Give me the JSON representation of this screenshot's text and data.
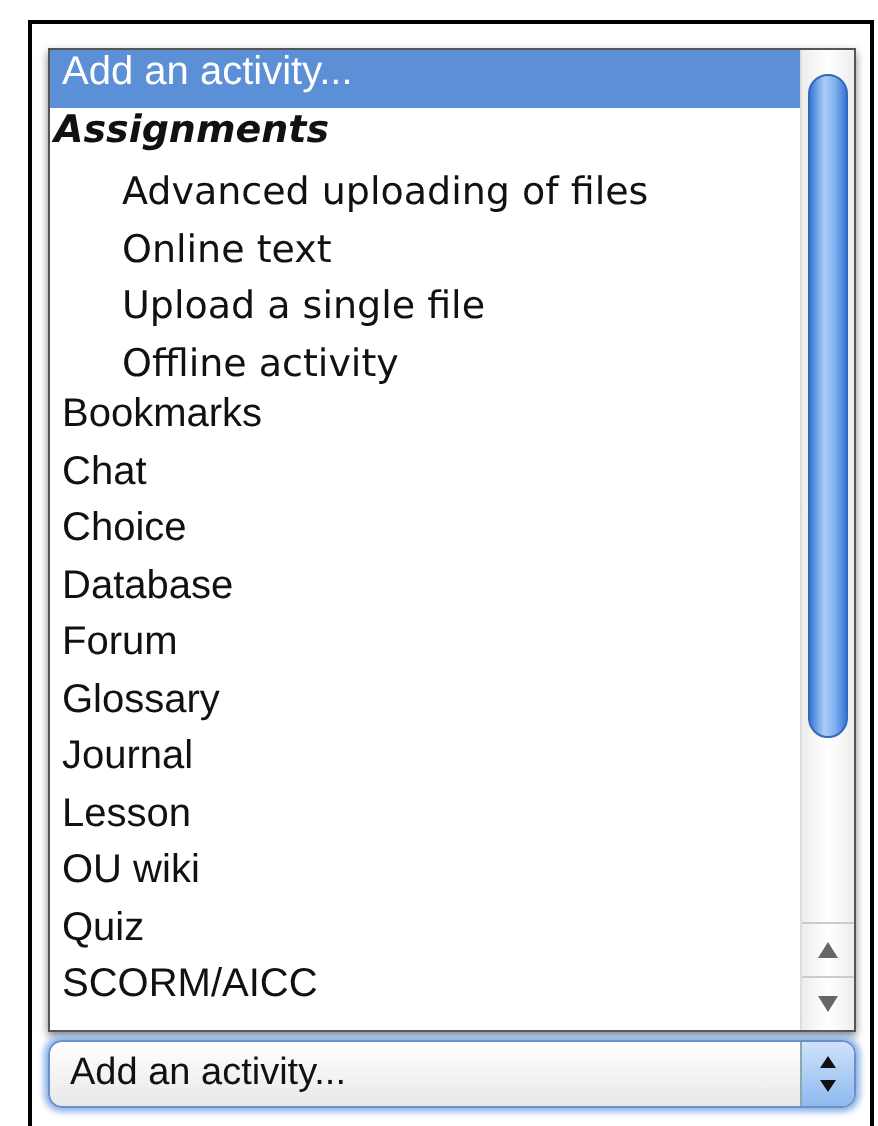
{
  "dropdown_list": {
    "items": [
      {
        "kind": "option",
        "label": "Add an activity...",
        "selected": true
      },
      {
        "kind": "group",
        "label": "Assignments",
        "children": [
          {
            "kind": "option",
            "label": "Advanced uploading of files",
            "selected": false
          },
          {
            "kind": "option",
            "label": "Online text",
            "selected": false
          },
          {
            "kind": "option",
            "label": "Upload a single file",
            "selected": false
          },
          {
            "kind": "option",
            "label": "Offline activity",
            "selected": false
          }
        ]
      },
      {
        "kind": "option",
        "label": "Bookmarks",
        "selected": false
      },
      {
        "kind": "option",
        "label": "Chat",
        "selected": false
      },
      {
        "kind": "option",
        "label": "Choice",
        "selected": false
      },
      {
        "kind": "option",
        "label": "Database",
        "selected": false
      },
      {
        "kind": "option",
        "label": "Forum",
        "selected": false
      },
      {
        "kind": "option",
        "label": "Glossary",
        "selected": false
      },
      {
        "kind": "option",
        "label": "Journal",
        "selected": false
      },
      {
        "kind": "option",
        "label": "Lesson",
        "selected": false
      },
      {
        "kind": "option",
        "label": "OU wiki",
        "selected": false
      },
      {
        "kind": "option",
        "label": "Quiz",
        "selected": false
      },
      {
        "kind": "option",
        "label": "SCORM/AICC",
        "selected": false
      }
    ]
  },
  "select": {
    "value": "Add an activity..."
  }
}
